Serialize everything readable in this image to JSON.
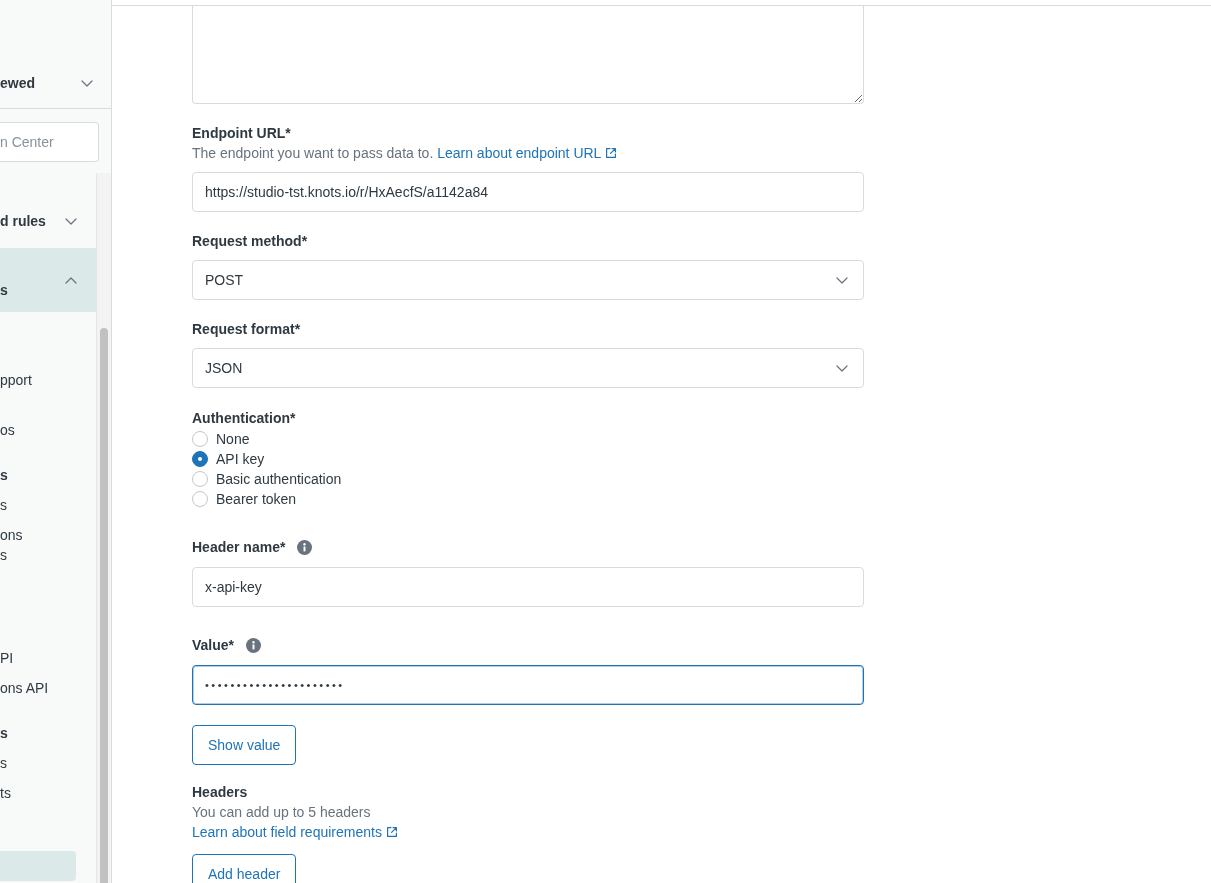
{
  "sidebar": {
    "recent": {
      "label": "ewed",
      "expanded": false
    },
    "search": {
      "placeholder": "n Center"
    },
    "groups": [
      {
        "label": "d rules",
        "expanded": false,
        "selected": false
      },
      {
        "label": "s",
        "expanded": true,
        "selected": true,
        "sections": [
          {
            "items": [
              {
                "label": "pport",
                "selected": false
              },
              {
                "label": "os",
                "selected": false
              }
            ]
          },
          {
            "heading": "s",
            "items": [
              {
                "label": "s",
                "selected": false
              },
              {
                "label": "ons\ns",
                "selected": false
              }
            ]
          },
          {
            "items": [
              {
                "label": "PI",
                "selected": false
              },
              {
                "label": "ons API",
                "selected": false
              }
            ]
          },
          {
            "heading": "s",
            "items": [
              {
                "label": "s",
                "selected": false
              },
              {
                "label": "ts",
                "selected": false
              }
            ]
          },
          {
            "items": [
              {
                "selected": true
              }
            ]
          }
        ]
      }
    ]
  },
  "form": {
    "fields": [
      {
        "kind": "textarea"
      },
      {
        "kind": "text",
        "label": "Endpoint URL*",
        "hint": "The endpoint you want to pass data to.",
        "link": "Learn about endpoint URL",
        "value": "https://studio-tst.knots.io/r/HxAecfS/a1142a84"
      },
      {
        "kind": "select",
        "label": "Request method*",
        "value": "POST"
      },
      {
        "kind": "select",
        "label": "Request format*",
        "value": "JSON"
      },
      {
        "kind": "radio",
        "label": "Authentication*",
        "options": [
          {
            "label": "None",
            "selected": false
          },
          {
            "label": "API key",
            "selected": true
          },
          {
            "label": "Basic authentication",
            "selected": false
          },
          {
            "label": "Bearer token",
            "selected": false
          }
        ]
      },
      {
        "kind": "text",
        "label": "Header name*",
        "info": true,
        "value": "x-api-key"
      },
      {
        "kind": "password",
        "label": "Value*",
        "info": true,
        "focused": true,
        "value": "••••••••••••••••••••••"
      },
      {
        "kind": "button",
        "label": "Show value"
      },
      {
        "kind": "info",
        "label": "Headers",
        "hint": "You can add up to 5 headers",
        "link": "Learn about field requirements"
      },
      {
        "kind": "button",
        "label": "Add header"
      }
    ]
  }
}
